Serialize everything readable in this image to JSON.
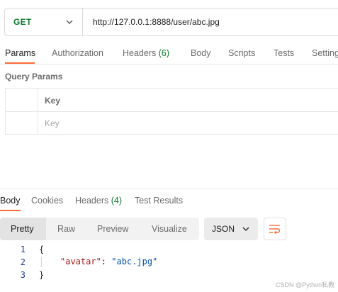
{
  "request": {
    "method": "GET",
    "url": "http://127.0.0.1:8888/user/abc.jpg"
  },
  "request_tabs": [
    {
      "label": "Params"
    },
    {
      "label": "Authorization"
    },
    {
      "label": "Headers",
      "count": "(6)"
    },
    {
      "label": "Body"
    },
    {
      "label": "Scripts"
    },
    {
      "label": "Tests"
    },
    {
      "label": "Settings"
    }
  ],
  "query_params": {
    "title": "Query Params",
    "key_header": "Key",
    "key_placeholder": "Key"
  },
  "response_tabs": [
    {
      "label": "Body"
    },
    {
      "label": "Cookies"
    },
    {
      "label": "Headers",
      "count": "(4)"
    },
    {
      "label": "Test Results"
    }
  ],
  "format_buttons": [
    "Pretty",
    "Raw",
    "Preview",
    "Visualize"
  ],
  "format_select": "JSON",
  "response_body": {
    "line_numbers": [
      "1",
      "2",
      "3"
    ],
    "open_brace": "{",
    "close_brace": "}",
    "key": "\"avatar\"",
    "colon": ": ",
    "value": "\"abc.jpg\""
  },
  "watermark": "CSDN @Python私教",
  "colors": {
    "method_green": "#0c7a2f",
    "accent_orange": "#ff6c37",
    "json_key": "#a31515",
    "json_string": "#0451a5"
  }
}
